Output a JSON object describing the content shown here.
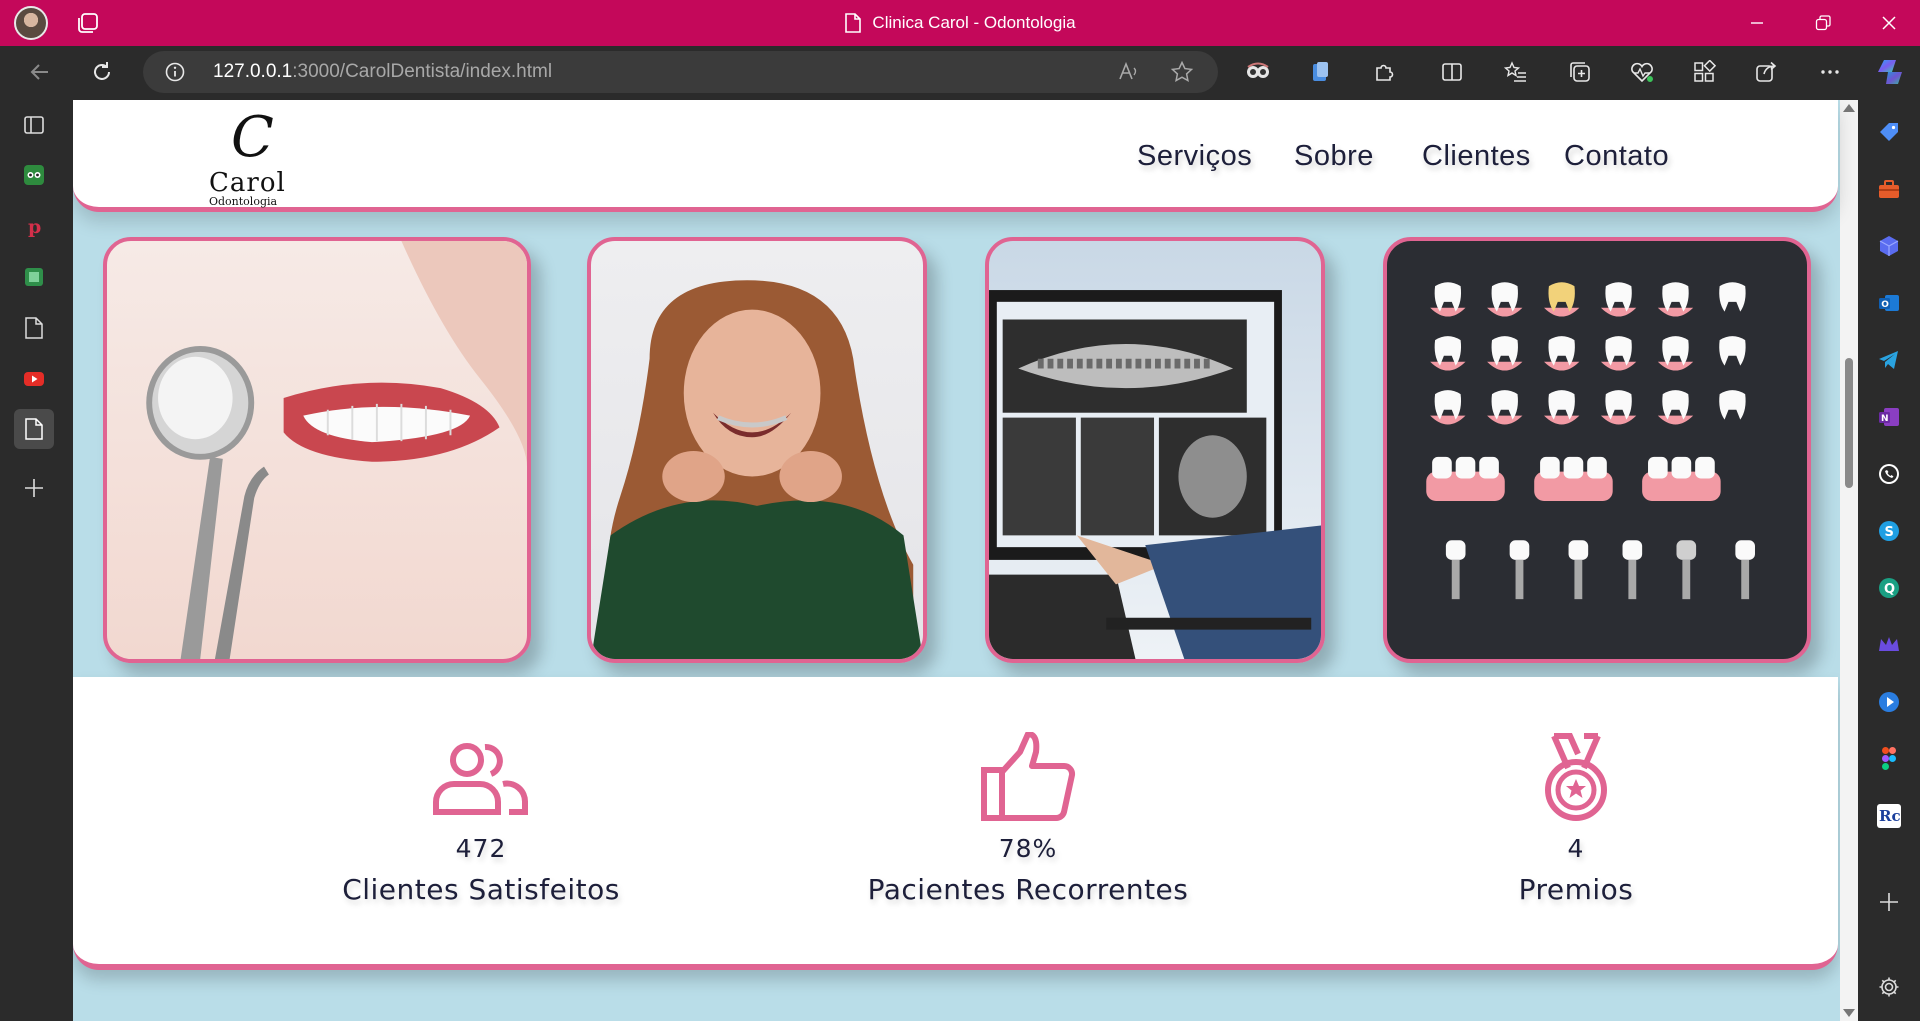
{
  "window": {
    "title": "Clinica Carol - Odontologia",
    "accent": "#c4085a"
  },
  "address": {
    "host": "127.0.0.1",
    "path": ":3000/CarolDentista/index.html"
  },
  "site": {
    "logo": {
      "mark": "C",
      "name": "Carol",
      "sub": "Odontologia"
    },
    "nav": [
      "Serviços",
      "Sobre",
      "Clientes",
      "Contato"
    ],
    "brand_pink": "#e06492",
    "page_bg": "#b9dde8",
    "stats": [
      {
        "icon": "users-icon",
        "value": "472",
        "label": "Clientes Satisfeitos"
      },
      {
        "icon": "thumbs-up-icon",
        "value": "78%",
        "label": "Pacientes Recorrentes"
      },
      {
        "icon": "medal-icon",
        "value": "4",
        "label": "Premios"
      }
    ]
  }
}
